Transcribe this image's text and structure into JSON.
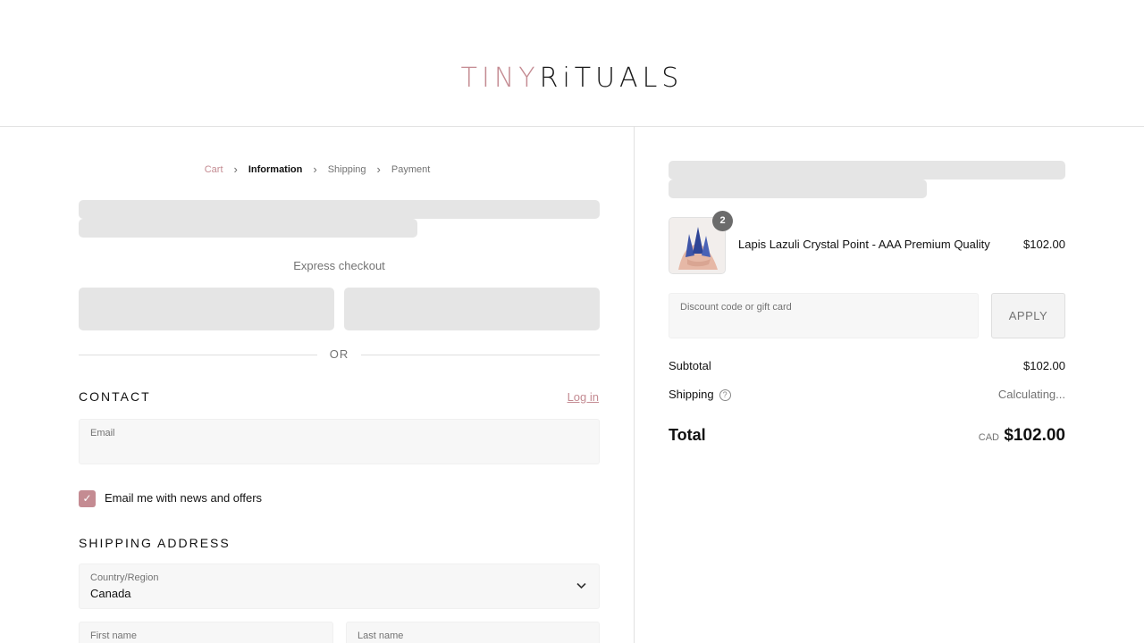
{
  "brand": {
    "logo_part1": "TINY",
    "logo_part2": "RiTUALS",
    "accent": "#c48b92"
  },
  "breadcrumb": [
    {
      "label": "Cart"
    },
    {
      "label": "Information"
    },
    {
      "label": "Shipping"
    },
    {
      "label": "Payment"
    }
  ],
  "express": {
    "label": "Express checkout"
  },
  "divider": {
    "label": "OR"
  },
  "contact": {
    "title": "CONTACT",
    "login_label": "Log in",
    "email_label": "Email",
    "newsletter_label": "Email me with news and offers",
    "newsletter_checked": true
  },
  "shipping": {
    "title": "SHIPPING ADDRESS",
    "country_label": "Country/Region",
    "country_value": "Canada",
    "first_name_label": "First name",
    "last_name_label": "Last name"
  },
  "order": {
    "item": {
      "name": "Lapis Lazuli Crystal Point - AAA Premium Quality",
      "price": "$102.00",
      "quantity": "2"
    },
    "discount_placeholder": "Discount code or gift card",
    "apply_label": "APPLY",
    "subtotal_label": "Subtotal",
    "subtotal_value": "$102.00",
    "shipping_label": "Shipping",
    "shipping_value": "Calculating...",
    "total_label": "Total",
    "currency": "CAD",
    "total_value": "$102.00"
  }
}
